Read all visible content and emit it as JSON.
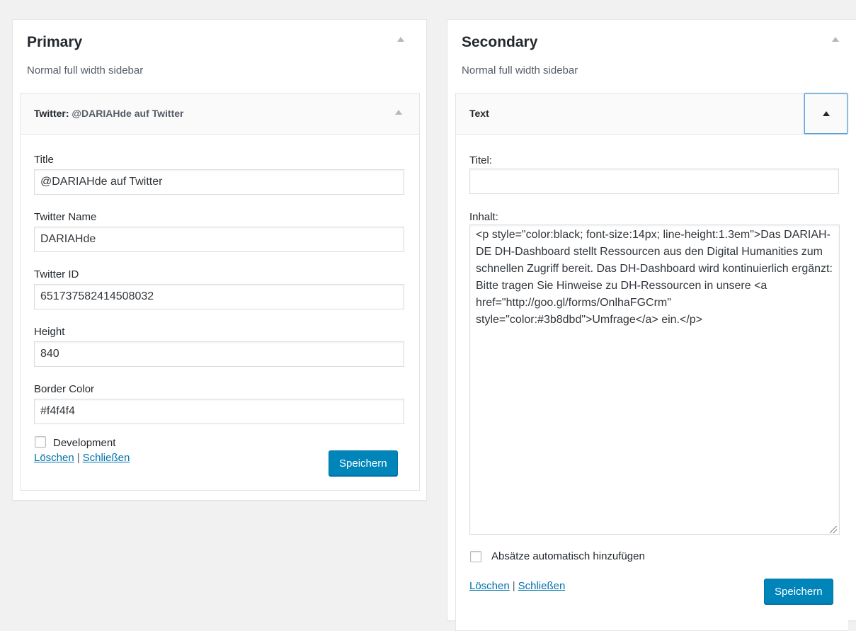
{
  "primary": {
    "title": "Primary",
    "description": "Normal full width sidebar",
    "widget": {
      "type_label": "Twitter:",
      "in_title": "@DARIAHde auf Twitter",
      "fields": [
        {
          "label": "Title",
          "value": "@DARIAHde auf Twitter"
        },
        {
          "label": "Twitter Name",
          "value": "DARIAHde"
        },
        {
          "label": "Twitter ID",
          "value": "651737582414508032"
        },
        {
          "label": "Height",
          "value": "840"
        },
        {
          "label": "Border Color",
          "value": "#f4f4f4"
        }
      ],
      "checkbox_label": "Development",
      "delete_label": "Löschen",
      "separator": "|",
      "close_label": "Schließen",
      "save_label": "Speichern"
    }
  },
  "secondary": {
    "title": "Secondary",
    "description": "Normal full width sidebar",
    "widget": {
      "type_label": "Text",
      "title_label": "Titel:",
      "title_value": "",
      "content_label": "Inhalt:",
      "content_value": "<p style=\"color:black; font-size:14px; line-height:1.3em\">Das DARIAH-DE DH-Dashboard stellt Ressourcen aus den Digital Humanities zum schnellen Zugriff bereit. Das DH-Dashboard wird kontinuierlich ergänzt: Bitte tragen Sie Hinweise zu DH-Ressourcen in unsere <a href=\"http://goo.gl/forms/OnlhaFGCrm\" style=\"color:#3b8dbd\">Umfrage</a> ein.</p>",
      "checkbox_label": "Absätze automatisch hinzufügen",
      "delete_label": "Löschen",
      "separator": "|",
      "close_label": "Schließen",
      "save_label": "Speichern"
    }
  },
  "colors": {
    "accent": "#0085ba",
    "link": "#0073aa",
    "background": "#f1f1f1"
  }
}
